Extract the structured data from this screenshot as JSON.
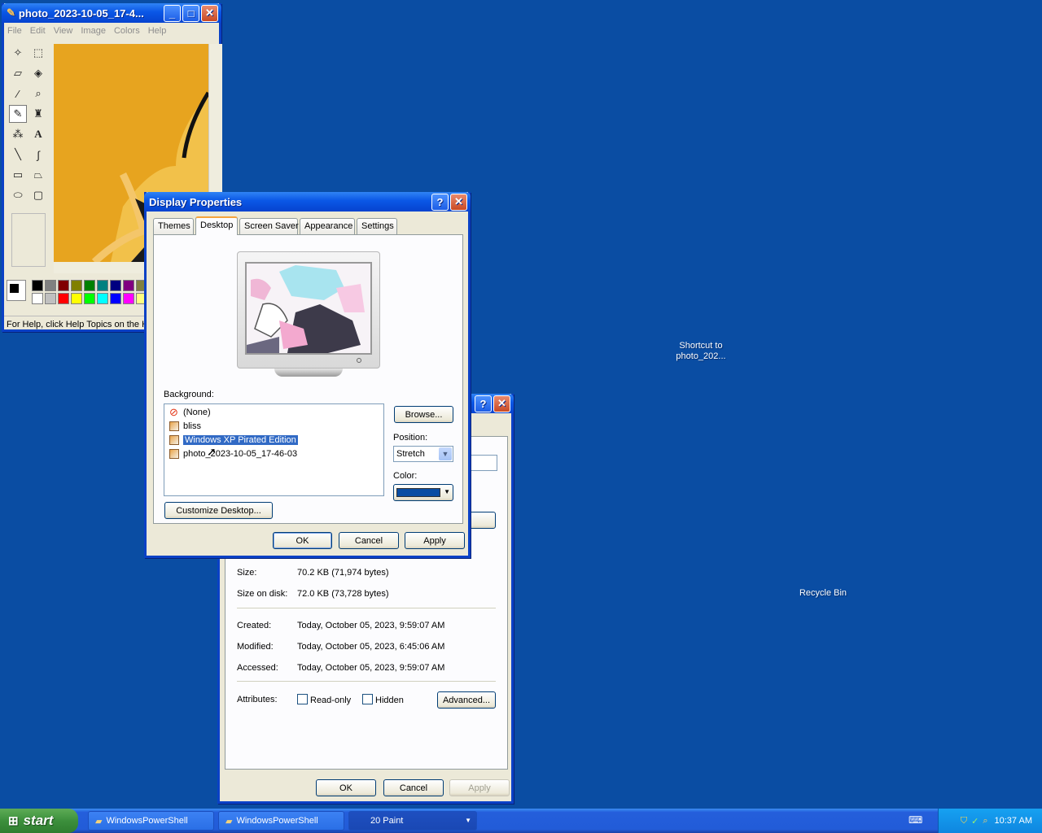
{
  "desktop": {
    "shortcut_label_line1": "Shortcut to",
    "shortcut_label_line2": "photo_202...",
    "recycle_bin_label": "Recycle Bin",
    "background_color": "#0a4da3"
  },
  "paint": {
    "title": "photo_2023-10-05_17-4...",
    "menu": [
      "File",
      "Edit",
      "View",
      "Image",
      "Colors",
      "Help"
    ],
    "status": "For Help, click Help Topics on the He"
  },
  "properties": {
    "title_controls": {
      "help": "?",
      "close": "✕"
    },
    "size_label": "Size:",
    "size_value": "70.2 KB (71,974 bytes)",
    "size_on_disk_label": "Size on disk:",
    "size_on_disk_value": "72.0 KB (73,728 bytes)",
    "created_label": "Created:",
    "created_value": "Today, October 05, 2023, 9:59:07 AM",
    "modified_label": "Modified:",
    "modified_value": "Today, October 05, 2023, 6:45:06 AM",
    "accessed_label": "Accessed:",
    "accessed_value": "Today, October 05, 2023, 9:59:07 AM",
    "attributes_label": "Attributes:",
    "readonly_label": "Read-only",
    "hidden_label": "Hidden",
    "advanced_button": "Advanced...",
    "ok_button": "OK",
    "cancel_button": "Cancel",
    "apply_button": "Apply"
  },
  "display": {
    "title": "Display Properties",
    "tabs": [
      "Themes",
      "Desktop",
      "Screen Saver",
      "Appearance",
      "Settings"
    ],
    "background_label": "Background:",
    "background_items": [
      "(None)",
      "bliss",
      "Windows XP Pirated Edition",
      "photo_2023-10-05_17-46-03"
    ],
    "browse_button": "Browse...",
    "position_label": "Position:",
    "position_value": "Stretch",
    "color_label": "Color:",
    "color_value": "#0a4da3",
    "customize_button": "Customize Desktop...",
    "ok_button": "OK",
    "cancel_button": "Cancel",
    "apply_button": "Apply"
  },
  "taskbar": {
    "start_label": "start",
    "buttons": [
      "WindowsPowerShell",
      "WindowsPowerShell",
      "20 Paint"
    ],
    "clock": "10:37 AM"
  }
}
